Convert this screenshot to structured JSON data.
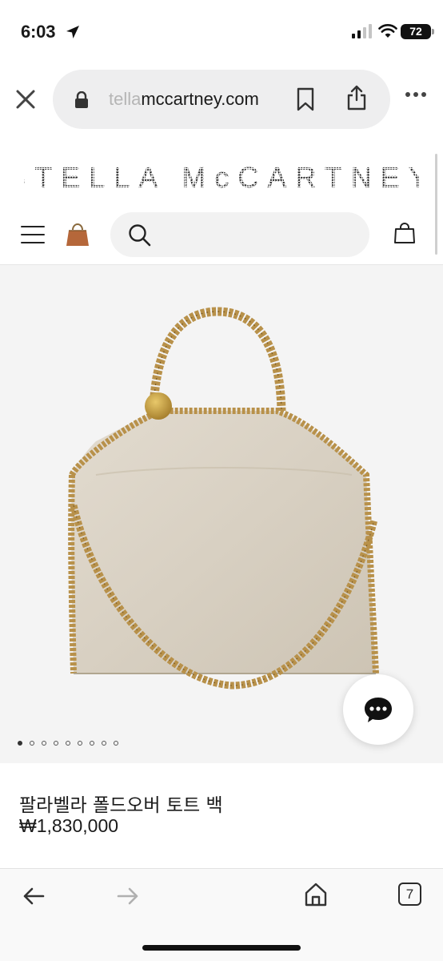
{
  "status_bar": {
    "time": "6:03",
    "battery": "72"
  },
  "browser": {
    "url_faded": "tella",
    "url_main": "mccartney.com",
    "open_tabs": "7"
  },
  "site": {
    "brand": "STELLA McCARTNEY",
    "search_placeholder": ""
  },
  "product": {
    "name": "팔라벨라 폴드오버 토트 백",
    "price": "₩1,830,000",
    "image_count": 9,
    "active_image_index": 0
  },
  "colors": {
    "bag_body": "#d8d0c2",
    "chain_gold": "#b8914a",
    "image_bg": "#f4f4f4",
    "thumb_bag": "#b5673a"
  }
}
